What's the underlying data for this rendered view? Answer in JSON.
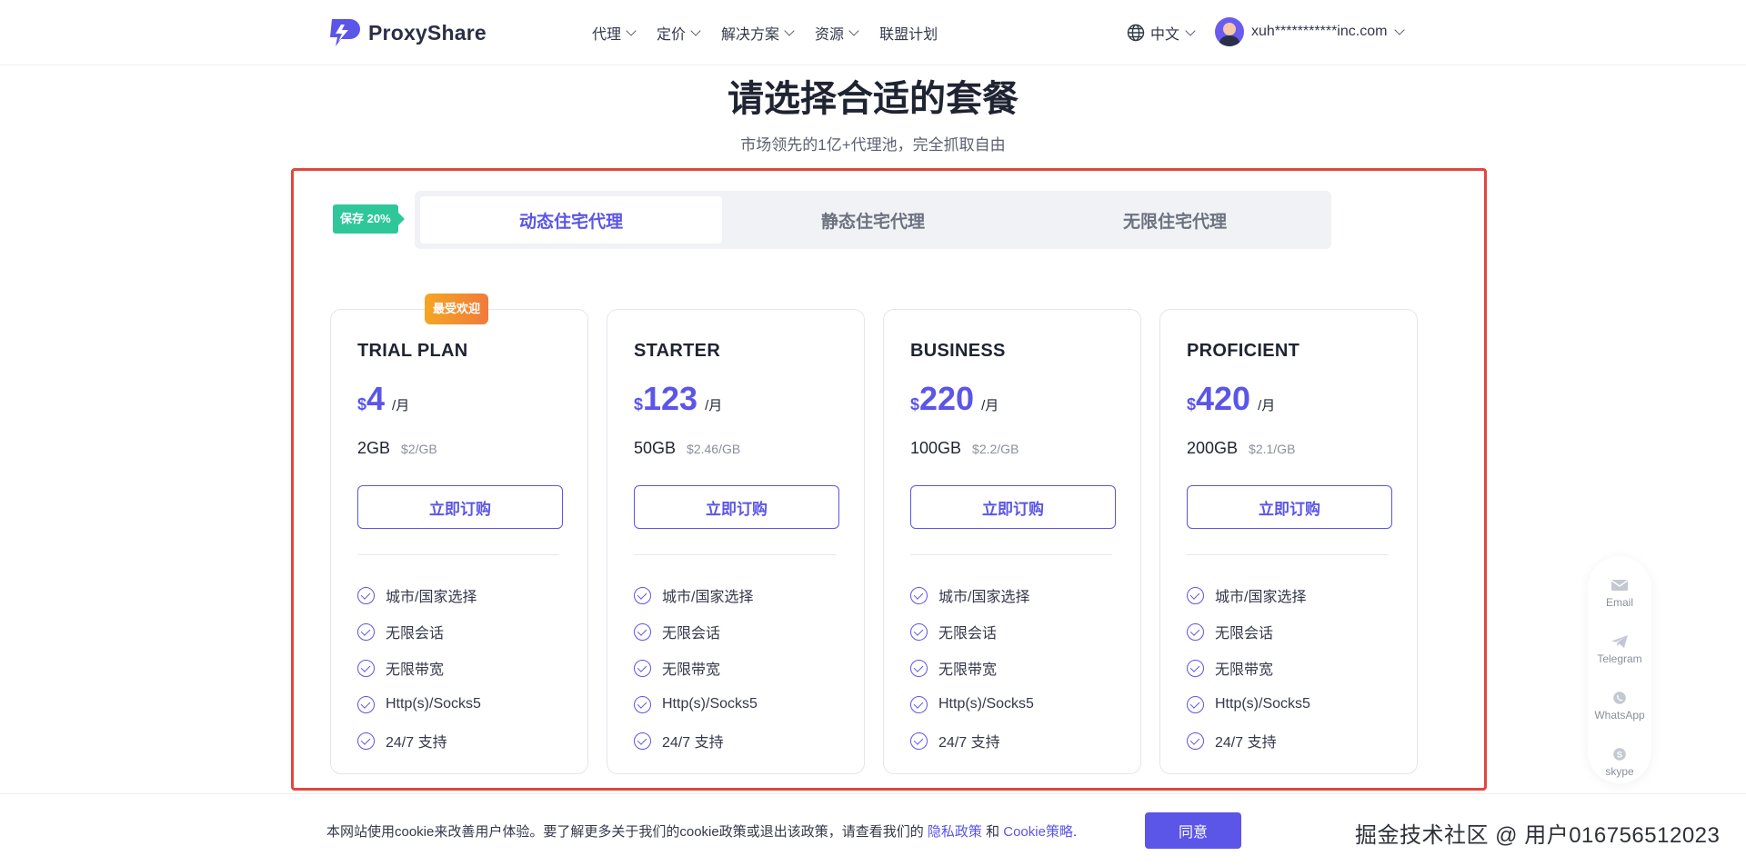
{
  "header": {
    "logo_text": "ProxyShare",
    "nav": [
      {
        "label": "代理",
        "has_dropdown": true
      },
      {
        "label": "定价",
        "has_dropdown": true
      },
      {
        "label": "解决方案",
        "has_dropdown": true
      },
      {
        "label": "资源",
        "has_dropdown": true
      },
      {
        "label": "联盟计划",
        "has_dropdown": false
      }
    ],
    "language": "中文",
    "user_email": "xuh***********inc.com",
    "icons": {
      "language": "globe-icon",
      "avatar": "user-avatar"
    }
  },
  "hero": {
    "title": "请选择合适的套餐",
    "subtitle": "市场领先的1亿+代理池，完全抓取自由"
  },
  "pricing": {
    "save_badge": "保存 20%",
    "tabs": [
      {
        "label": "动态住宅代理",
        "active": true
      },
      {
        "label": "静态住宅代理",
        "active": false
      },
      {
        "label": "无限住宅代理",
        "active": false
      }
    ],
    "popular_badge": "最受欢迎",
    "plans": [
      {
        "name": "TRIAL PLAN",
        "currency": "$",
        "price": "4",
        "period": "/月",
        "traffic": "2GB",
        "unit_price": "$2/GB",
        "cta": "立即订购",
        "popular": true
      },
      {
        "name": "STARTER",
        "currency": "$",
        "price": "123",
        "period": "/月",
        "traffic": "50GB",
        "unit_price": "$2.46/GB",
        "cta": "立即订购",
        "popular": false
      },
      {
        "name": "BUSINESS",
        "currency": "$",
        "price": "220",
        "period": "/月",
        "traffic": "100GB",
        "unit_price": "$2.2/GB",
        "cta": "立即订购",
        "popular": false
      },
      {
        "name": "PROFICIENT",
        "currency": "$",
        "price": "420",
        "period": "/月",
        "traffic": "200GB",
        "unit_price": "$2.1/GB",
        "cta": "立即订购",
        "popular": false
      }
    ],
    "features": [
      "城市/国家选择",
      "无限会话",
      "无限带宽",
      "Http(s)/Socks5",
      "24/7 支持"
    ]
  },
  "contact": [
    {
      "label": "Email",
      "icon": "email-icon"
    },
    {
      "label": "Telegram",
      "icon": "telegram-icon"
    },
    {
      "label": "WhatsApp",
      "icon": "whatsapp-icon"
    },
    {
      "label": "skype",
      "icon": "skype-icon"
    }
  ],
  "cookie": {
    "text": "本网站使用cookie来改善用户体验。要了解更多关于我们的cookie政策或退出该政策，请查看我们的 ",
    "privacy_link": "隐私政策",
    "and": " 和 ",
    "cookie_link": "Cookie策略",
    "period": ".",
    "agree": "同意"
  },
  "watermark": "掘金技术社区 @ 用户016756512023",
  "colors": {
    "accent": "#5b55e8",
    "save_badge": "#2fc79a",
    "popular_badge": "#f5a623",
    "frame": "#e0473f"
  }
}
